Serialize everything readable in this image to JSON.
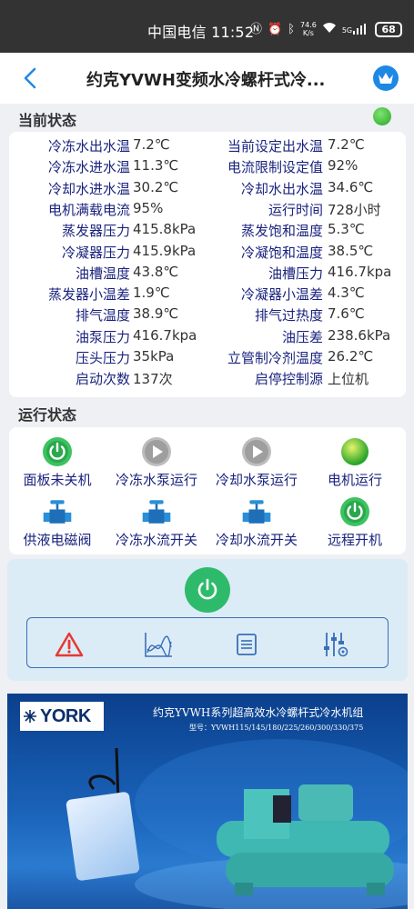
{
  "status_bar": {
    "carrier_time": "中国电信 11:52",
    "net_speed_value": "74.6",
    "net_speed_unit": "K/s",
    "signal_label": "5G",
    "battery": "68"
  },
  "header": {
    "title": "约克YVWH变频水冷螺杆式冷..."
  },
  "current_status": {
    "heading": "当前状态",
    "indicator_color": "#3cc43c",
    "params": [
      {
        "l1": "冷冻水出水温",
        "v1": "7.2℃",
        "l2": "当前设定出水温",
        "v2": "7.2℃"
      },
      {
        "l1": "冷冻水进水温",
        "v1": "11.3℃",
        "l2": "电流限制设定值",
        "v2": "92%"
      },
      {
        "l1": "冷却水进水温",
        "v1": "30.2℃",
        "l2": "冷却水出水温",
        "v2": "34.6℃"
      },
      {
        "l1": "电机满载电流",
        "v1": "95%",
        "l2": "运行时间",
        "v2": "728小时"
      },
      {
        "l1": "蒸发器压力",
        "v1": "415.8kPa",
        "l2": "蒸发饱和温度",
        "v2": "5.3℃"
      },
      {
        "l1": "冷凝器压力",
        "v1": "415.9kPa",
        "l2": "冷凝饱和温度",
        "v2": "38.5℃"
      },
      {
        "l1": "油槽温度",
        "v1": "43.8℃",
        "l2": "油槽压力",
        "v2": "416.7kpa"
      },
      {
        "l1": "蒸发器小温差",
        "v1": "1.9℃",
        "l2": "冷凝器小温差",
        "v2": "4.3℃"
      },
      {
        "l1": "排气温度",
        "v1": "38.9℃",
        "l2": "排气过热度",
        "v2": "7.6℃"
      },
      {
        "l1": "油泵压力",
        "v1": "416.7kpa",
        "l2": "油压差",
        "v2": "238.6kPa"
      },
      {
        "l1": "压头压力",
        "v1": "35kPa",
        "l2": "立管制冷剂温度",
        "v2": "26.2℃"
      },
      {
        "l1": "启动次数",
        "v1": "137次",
        "l2": "启停控制源",
        "v2": "上位机"
      }
    ]
  },
  "run_status": {
    "heading": "运行状态",
    "items": [
      {
        "label": "面板未关机",
        "icon": "power-on-icon"
      },
      {
        "label": "冷冻水泵运行",
        "icon": "play-icon"
      },
      {
        "label": "冷却水泵运行",
        "icon": "play-icon"
      },
      {
        "label": "电机运行",
        "icon": "green-light-icon"
      },
      {
        "label": "供液电磁阀",
        "icon": "valve-icon"
      },
      {
        "label": "冷冻水流开关",
        "icon": "valve-icon"
      },
      {
        "label": "冷却水流开关",
        "icon": "valve-icon"
      },
      {
        "label": "远程开机",
        "icon": "power-on-icon"
      }
    ]
  },
  "controls": {
    "tools": [
      "alarm-icon",
      "trend-chart-icon",
      "list-icon",
      "settings-sliders-icon"
    ]
  },
  "banner": {
    "brand": "YORK",
    "title": "约克YVWH系列超高效水冷螺杆式冷水机组",
    "model": "型号：YVWH115/145/180/225/260/300/330/375"
  },
  "colors": {
    "label": "#1a237e",
    "accent_blue": "#1e88e5",
    "green": "#2dbb6b",
    "grey_icon": "#9e9e9e"
  }
}
